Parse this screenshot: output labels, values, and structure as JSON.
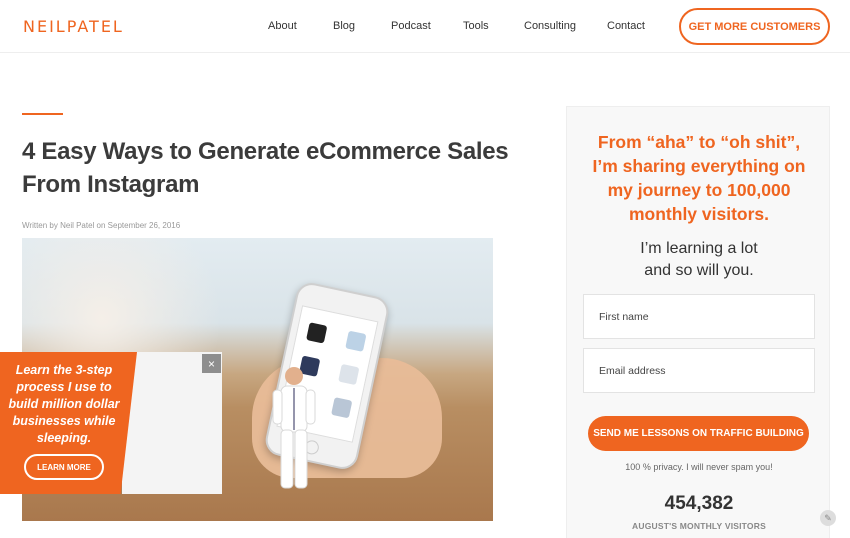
{
  "header": {
    "logo": "NEILPATEL",
    "nav": [
      "About",
      "Blog",
      "Podcast",
      "Tools",
      "Consulting",
      "Contact"
    ],
    "cta": "GET MORE CUSTOMERS"
  },
  "article": {
    "title": "4 Easy Ways to Generate eCommerce Sales From Instagram",
    "byline": "Written by Neil Patel on September 26, 2016"
  },
  "promo": {
    "text": "Learn the 3-step process I use to build million dollar businesses while sleeping.",
    "button": "LEARN MORE",
    "close": "×"
  },
  "sidebar": {
    "headline": "From “aha” to “oh shit”, I’m sharing everything on my journey to 100,000 monthly visitors.",
    "subhead": "I’m learning a lot and so will you.",
    "first_name_placeholder": "First name",
    "email_placeholder": "Email address",
    "button": "SEND ME LESSONS ON TRAFFIC BUILDING",
    "privacy": "100 % privacy. I will never spam you!",
    "visitors_count": "454,382",
    "visitors_label": "AUGUST'S MONTHLY VISITORS"
  },
  "colors": {
    "accent": "#ef6520"
  }
}
